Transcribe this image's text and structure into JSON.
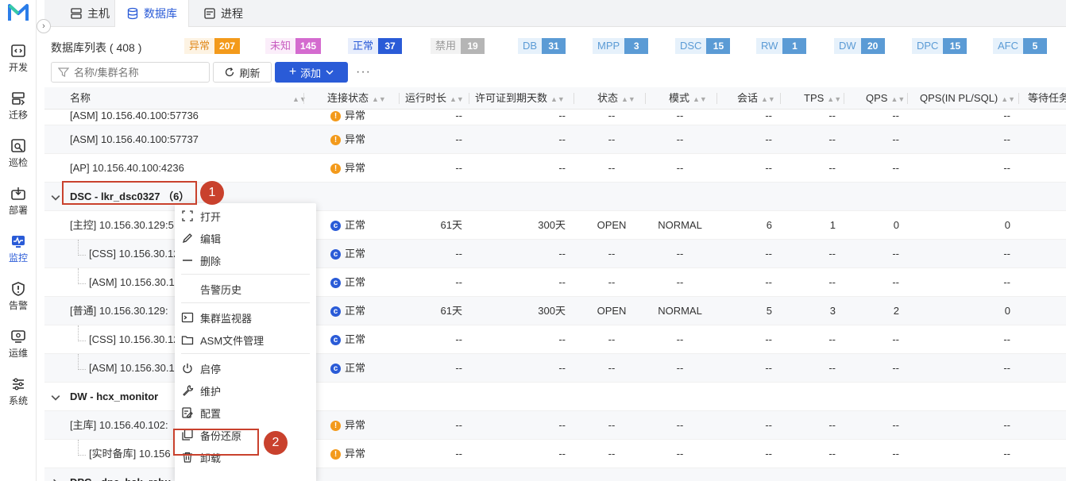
{
  "sidebar": {
    "logo": "M",
    "items": [
      {
        "label": "开发",
        "icon": "code-icon"
      },
      {
        "label": "迁移",
        "icon": "migrate-icon"
      },
      {
        "label": "巡检",
        "icon": "inspect-icon"
      },
      {
        "label": "部署",
        "icon": "deploy-icon"
      },
      {
        "label": "监控",
        "icon": "monitor-icon",
        "active": true
      },
      {
        "label": "告警",
        "icon": "alert-icon"
      },
      {
        "label": "运维",
        "icon": "ops-icon"
      },
      {
        "label": "系统",
        "icon": "settings-icon"
      }
    ]
  },
  "tabs": [
    {
      "label": "主机",
      "icon": "host-icon"
    },
    {
      "label": "数据库",
      "icon": "database-icon",
      "active": true
    },
    {
      "label": "进程",
      "icon": "process-icon"
    }
  ],
  "summary": {
    "list_title": "数据库列表 ( 408 )",
    "stats": [
      {
        "label": "异常",
        "count": "207",
        "label_bg": "#fdf3e3",
        "label_color": "#e08a1e",
        "count_bg": "#f39a1b"
      },
      {
        "label": "未知",
        "count": "145",
        "label_bg": "#fbeefa",
        "label_color": "#c85cc0",
        "count_bg": "#d46bcf"
      },
      {
        "label": "正常",
        "count": "37",
        "label_bg": "#e8eefc",
        "label_color": "#2a5bd7",
        "count_bg": "#2a5bd7"
      },
      {
        "label": "禁用",
        "count": "19",
        "label_bg": "#f2f2f2",
        "label_color": "#999999",
        "count_bg": "#b5b5b5"
      },
      {
        "label": "DB",
        "count": "31",
        "label_bg": "#e6f1fb",
        "label_color": "#5b9bd5",
        "count_bg": "#5b9bd5"
      },
      {
        "label": "MPP",
        "count": "3",
        "label_bg": "#e6f1fb",
        "label_color": "#5b9bd5",
        "count_bg": "#5b9bd5"
      },
      {
        "label": "DSC",
        "count": "15",
        "label_bg": "#e6f1fb",
        "label_color": "#5b9bd5",
        "count_bg": "#5b9bd5"
      },
      {
        "label": "RW",
        "count": "1",
        "label_bg": "#e6f1fb",
        "label_color": "#5b9bd5",
        "count_bg": "#5b9bd5"
      },
      {
        "label": "DW",
        "count": "20",
        "label_bg": "#e6f1fb",
        "label_color": "#5b9bd5",
        "count_bg": "#5b9bd5"
      },
      {
        "label": "DPC",
        "count": "15",
        "label_bg": "#e6f1fb",
        "label_color": "#5b9bd5",
        "count_bg": "#5b9bd5"
      },
      {
        "label": "AFC",
        "count": "5",
        "label_bg": "#e6f1fb",
        "label_color": "#5b9bd5",
        "count_bg": "#5b9bd5"
      }
    ]
  },
  "toolbar": {
    "search_placeholder": "名称/集群名称",
    "refresh_label": "刷新",
    "add_label": "添加",
    "more_label": "···"
  },
  "table": {
    "columns": [
      "名称",
      "连接状态",
      "运行时长",
      "许可证到期天数",
      "状态",
      "模式",
      "会话",
      "TPS",
      "QPS",
      "QPS(IN PL/SQL)",
      "等待任务"
    ],
    "rows": [
      {
        "kind": "item",
        "name": "[ASM] 10.156.40.100:57736",
        "conn": "异常",
        "conn_type": "warn",
        "uptime": "--",
        "license": "--",
        "state": "--",
        "mode": "--",
        "sessions": "--",
        "tps": "--",
        "qps": "--",
        "qpspl": "--"
      },
      {
        "kind": "item",
        "name": "[ASM] 10.156.40.100:57737",
        "conn": "异常",
        "conn_type": "warn",
        "uptime": "--",
        "license": "--",
        "state": "--",
        "mode": "--",
        "sessions": "--",
        "tps": "--",
        "qps": "--",
        "qpspl": "--"
      },
      {
        "kind": "item",
        "name": "[AP] 10.156.40.100:4236",
        "conn": "异常",
        "conn_type": "warn",
        "uptime": "--",
        "license": "--",
        "state": "--",
        "mode": "--",
        "sessions": "--",
        "tps": "--",
        "qps": "--",
        "qpspl": "--"
      },
      {
        "kind": "group",
        "name": "DSC - lkr_dsc0327 （6）",
        "expanded": true
      },
      {
        "kind": "item",
        "name": "[主控] 10.156.30.129:5",
        "conn": "正常",
        "conn_type": "ok",
        "uptime": "61天",
        "license": "300天",
        "state": "OPEN",
        "mode": "NORMAL",
        "sessions": "6",
        "tps": "1",
        "qps": "0",
        "qpspl": "0"
      },
      {
        "kind": "child",
        "name": "[CSS] 10.156.30.12",
        "conn": "正常",
        "conn_type": "ok",
        "uptime": "--",
        "license": "--",
        "state": "--",
        "mode": "--",
        "sessions": "--",
        "tps": "--",
        "qps": "--",
        "qpspl": "--"
      },
      {
        "kind": "child",
        "name": "[ASM] 10.156.30.1",
        "conn": "正常",
        "conn_type": "ok",
        "uptime": "--",
        "license": "--",
        "state": "--",
        "mode": "--",
        "sessions": "--",
        "tps": "--",
        "qps": "--",
        "qpspl": "--"
      },
      {
        "kind": "item",
        "name": "[普通] 10.156.30.129:",
        "conn": "正常",
        "conn_type": "ok",
        "uptime": "61天",
        "license": "300天",
        "state": "OPEN",
        "mode": "NORMAL",
        "sessions": "5",
        "tps": "3",
        "qps": "2",
        "qpspl": "0"
      },
      {
        "kind": "child",
        "name": "[CSS] 10.156.30.12",
        "conn": "正常",
        "conn_type": "ok",
        "uptime": "--",
        "license": "--",
        "state": "--",
        "mode": "--",
        "sessions": "--",
        "tps": "--",
        "qps": "--",
        "qpspl": "--"
      },
      {
        "kind": "child",
        "name": "[ASM] 10.156.30.1",
        "conn": "正常",
        "conn_type": "ok",
        "uptime": "--",
        "license": "--",
        "state": "--",
        "mode": "--",
        "sessions": "--",
        "tps": "--",
        "qps": "--",
        "qpspl": "--"
      },
      {
        "kind": "group",
        "name": "DW - hcx_monitor",
        "expanded": true
      },
      {
        "kind": "item",
        "name": "[主库] 10.156.40.102:",
        "conn": "异常",
        "conn_type": "warn",
        "uptime": "--",
        "license": "--",
        "state": "--",
        "mode": "--",
        "sessions": "--",
        "tps": "--",
        "qps": "--",
        "qpspl": "--"
      },
      {
        "kind": "child",
        "name": "[实时备库] 10.156",
        "conn": "异常",
        "conn_type": "warn",
        "uptime": "--",
        "license": "--",
        "state": "--",
        "mode": "--",
        "sessions": "--",
        "tps": "--",
        "qps": "--",
        "qpspl": "--"
      },
      {
        "kind": "group",
        "name": "DPC - dpc_bak_rebu",
        "expanded": false
      }
    ]
  },
  "context_menu": {
    "items": [
      {
        "label": "打开",
        "icon": "open-icon"
      },
      {
        "label": "编辑",
        "icon": "edit-icon"
      },
      {
        "label": "删除",
        "icon": "delete-icon"
      },
      {
        "divider": true
      },
      {
        "label": "告警历史",
        "icon": ""
      },
      {
        "divider": true
      },
      {
        "label": "集群监视器",
        "icon": "terminal-icon"
      },
      {
        "label": "ASM文件管理",
        "icon": "folder-icon"
      },
      {
        "divider": true
      },
      {
        "label": "启停",
        "icon": "power-icon"
      },
      {
        "label": "维护",
        "icon": "wrench-icon"
      },
      {
        "label": "配置",
        "icon": "config-icon"
      },
      {
        "label": "备份还原",
        "icon": "backup-icon"
      },
      {
        "label": "卸载",
        "icon": "trash-icon"
      }
    ]
  },
  "annotations": [
    {
      "label": "1"
    },
    {
      "label": "2"
    }
  ]
}
